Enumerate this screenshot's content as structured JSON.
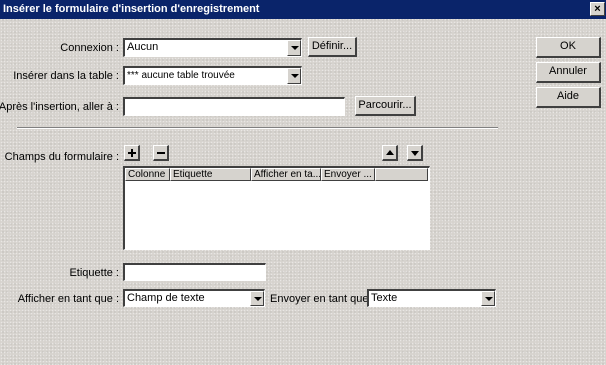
{
  "window": {
    "title": "Insérer le formulaire d'insertion d'enregistrement",
    "close_glyph": "×"
  },
  "connection": {
    "label": "Connexion :",
    "value": "Aucun",
    "define_button": "Définir..."
  },
  "table": {
    "label": "Insérer dans la table :",
    "value": "*** aucune table trouvée"
  },
  "after_insert": {
    "label": "Après l'insertion, aller à :",
    "value": "",
    "browse_button": "Parcourir..."
  },
  "form_fields": {
    "label": "Champs du formulaire :",
    "add_icon": "plus-icon",
    "remove_icon": "minus-icon",
    "move_up_icon": "arrow-up-icon",
    "move_down_icon": "arrow-down-icon",
    "columns": [
      "Colonne",
      "Etiquette",
      "Afficher en ta...",
      "Envoyer ..."
    ],
    "rows": []
  },
  "etiquette": {
    "label": "Etiquette :",
    "value": ""
  },
  "display_as": {
    "label": "Afficher en tant que :",
    "value": "Champ de texte"
  },
  "submit_as": {
    "label": "Envoyer en tant que :",
    "value": "Texte"
  },
  "actions": {
    "ok": "OK",
    "cancel": "Annuler",
    "help": "Aide"
  }
}
